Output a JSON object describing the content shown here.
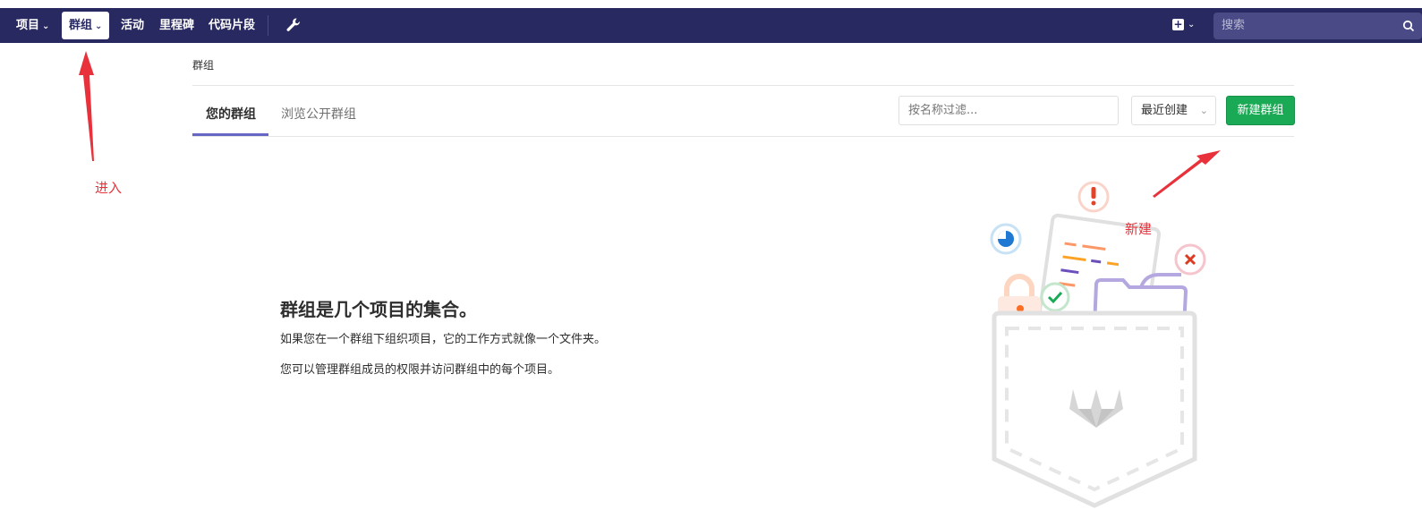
{
  "nav": {
    "projects": "项目",
    "groups": "群组",
    "activity": "活动",
    "milestones": "里程碑",
    "snippets": "代码片段",
    "search_placeholder": "搜索"
  },
  "breadcrumb": "群组",
  "tabs": [
    {
      "label": "您的群组",
      "active": true
    },
    {
      "label": "浏览公开群组",
      "active": false
    }
  ],
  "filter": {
    "placeholder": "按名称过滤..."
  },
  "sort": {
    "selected": "最近创建"
  },
  "new_group_button": "新建群组",
  "empty_state": {
    "title": "群组是几个项目的集合。",
    "line1": "如果您在一个群组下组织项目，它的工作方式就像一个文件夹。",
    "line2": "您可以管理群组成员的权限并访问群组中的每个项目。"
  },
  "annotations": {
    "enter": "进入",
    "create": "新建"
  },
  "colors": {
    "navbar": "#292961",
    "accent_green": "#1aaa55",
    "tab_underline": "#6666c4",
    "annotation_red": "#e8313a"
  },
  "icons": [
    "chevron-down-icon",
    "wrench-icon",
    "plus-square-icon",
    "search-icon"
  ]
}
